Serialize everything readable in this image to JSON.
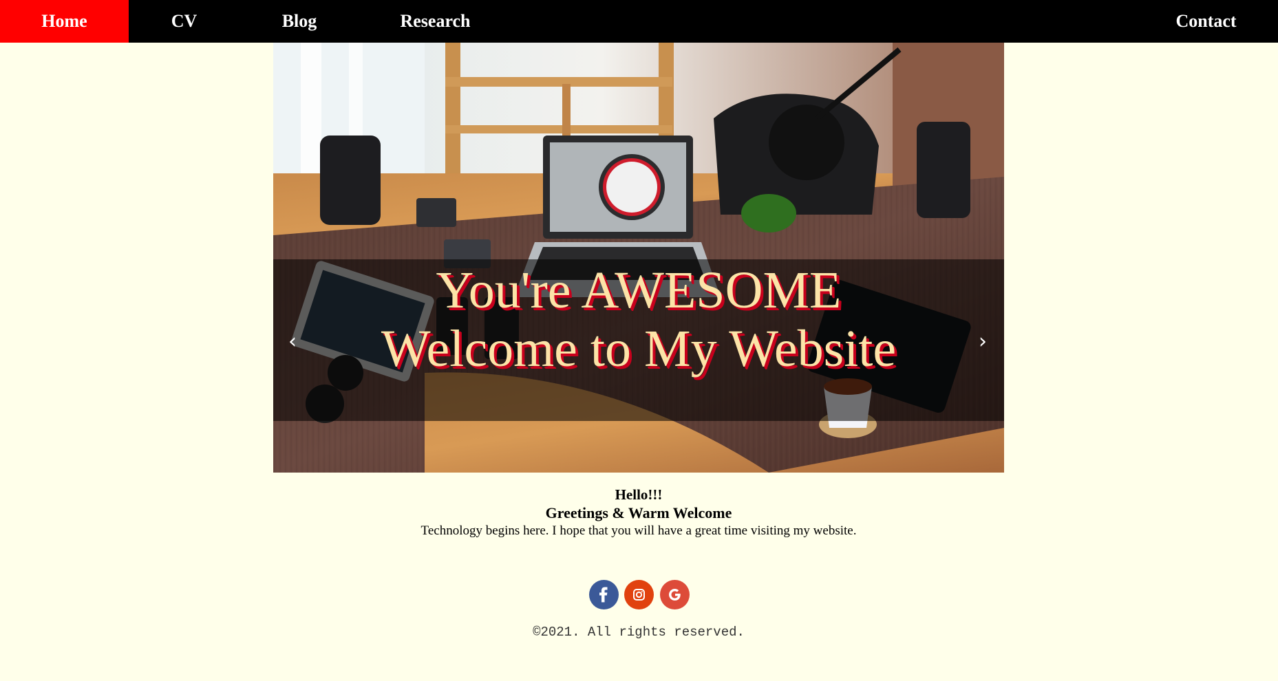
{
  "nav": {
    "items": [
      {
        "label": "Home",
        "active": true
      },
      {
        "label": "CV",
        "active": false
      },
      {
        "label": "Blog",
        "active": false
      },
      {
        "label": "Research",
        "active": false
      }
    ],
    "contact_label": "Contact",
    "colors": {
      "bar": "#000000",
      "active": "#ff0000",
      "text": "#ffffff"
    }
  },
  "hero": {
    "image": "desk-workspace-photo",
    "caption_line1": "You're AWESOME",
    "caption_line2": "Welcome to My Website",
    "prev_icon": "chevron-left-icon",
    "next_icon": "chevron-right-icon",
    "prev_glyph": "‹",
    "next_glyph": "›"
  },
  "intro": {
    "hello": "Hello!!!",
    "greeting": "Greetings & Warm Welcome",
    "text": "Technology begins here. I hope that you will have a great time visiting my website."
  },
  "social": [
    {
      "icon": "facebook-icon",
      "color": "#3b5998"
    },
    {
      "icon": "instagram-icon",
      "color": "#e1420f"
    },
    {
      "icon": "google-icon",
      "color": "#dd4b39"
    }
  ],
  "footer": {
    "copyright": "©2021. All rights reserved."
  },
  "colors": {
    "page_background": "#ffffea"
  }
}
